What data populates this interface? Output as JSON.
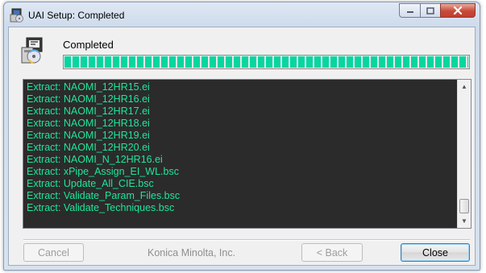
{
  "window": {
    "title": "UAI Setup: Completed"
  },
  "status": {
    "text": "Completed",
    "progress": 1.0,
    "progress_color": "#06d6a0"
  },
  "log": {
    "text_color": "#1ee69a",
    "background": "#2b2b2b",
    "lines": [
      "Extract: NAOMI_12HR15.ei",
      "Extract: NAOMI_12HR16.ei",
      "Extract: NAOMI_12HR17.ei",
      "Extract: NAOMI_12HR18.ei",
      "Extract: NAOMI_12HR19.ei",
      "Extract: NAOMI_12HR20.ei",
      "Extract: NAOMI_N_12HR16.ei",
      "Extract: xPipe_Assign_EI_WL.bsc",
      "Extract: Update_All_CIE.bsc",
      "Extract: Validate_Param_Files.bsc",
      "Extract: Validate_Techniques.bsc"
    ]
  },
  "footer": {
    "cancel_label": "Cancel",
    "company": "Konica Minolta, Inc.",
    "back_label": "< Back",
    "close_label": "Close"
  },
  "icons": {
    "app": "installer-icon",
    "setup": "installer-disc-icon",
    "minimize": "minimize-icon",
    "maximize": "maximize-icon",
    "close": "close-icon"
  }
}
